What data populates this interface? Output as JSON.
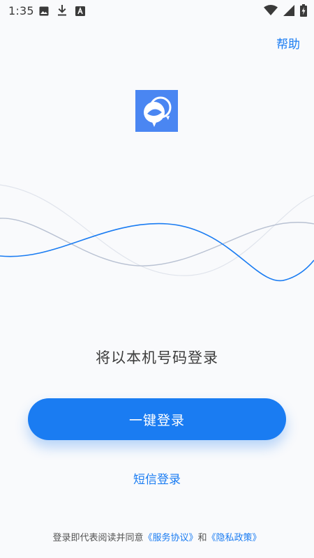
{
  "status_bar": {
    "time": "1:35",
    "left_icons": [
      "image-icon",
      "download-icon",
      "a-box-icon"
    ],
    "right_icons": [
      "wifi-icon",
      "signal-icon",
      "battery-charging-icon"
    ]
  },
  "header": {
    "help_label": "帮助"
  },
  "logo": {
    "icon": "astronaut-helmet-icon",
    "background_color": "#4a86f2"
  },
  "main": {
    "hint": "将以本机号码登录",
    "one_click_label": "一键登录",
    "sms_label": "短信登录"
  },
  "footer": {
    "prefix": "登录即代表阅读并同意",
    "service_agreement": "《服务协议》",
    "conjunction": "和",
    "privacy_policy": "《隐私政策》"
  },
  "colors": {
    "accent": "#1a7cf2",
    "background": "#f9fafc"
  }
}
